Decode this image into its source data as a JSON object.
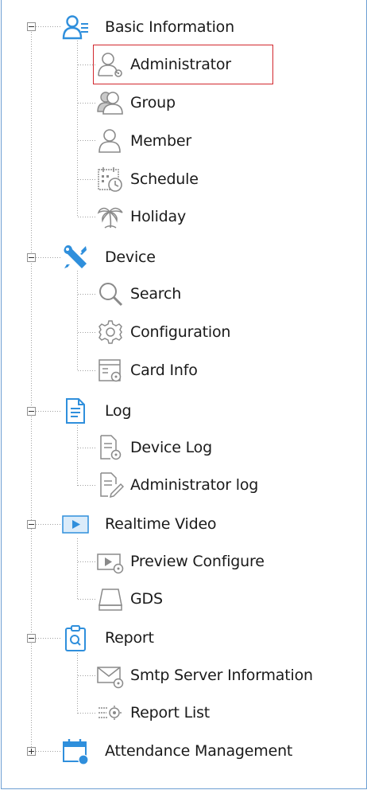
{
  "tree": {
    "groups": [
      {
        "label": "Basic Information",
        "icon": "user-list-icon",
        "expanded": true,
        "children": [
          {
            "label": "Administrator",
            "icon": "admin-user-gear-icon",
            "selected": true
          },
          {
            "label": "Group",
            "icon": "user-group-icon"
          },
          {
            "label": "Member",
            "icon": "user-icon"
          },
          {
            "label": "Schedule",
            "icon": "calendar-clock-icon"
          },
          {
            "label": "Holiday",
            "icon": "palm-tree-icon"
          }
        ]
      },
      {
        "label": "Device",
        "icon": "tools-icon",
        "expanded": true,
        "children": [
          {
            "label": "Search",
            "icon": "magnifier-icon"
          },
          {
            "label": "Configuration",
            "icon": "gear-icon"
          },
          {
            "label": "Card Info",
            "icon": "card-gear-icon"
          }
        ]
      },
      {
        "label": "Log",
        "icon": "document-icon",
        "expanded": true,
        "children": [
          {
            "label": "Device Log",
            "icon": "document-gear-icon"
          },
          {
            "label": "Administrator log",
            "icon": "document-pen-icon"
          }
        ]
      },
      {
        "label": "Realtime Video",
        "icon": "play-icon",
        "expanded": true,
        "children": [
          {
            "label": "Preview Configure",
            "icon": "play-gear-icon"
          },
          {
            "label": "GDS",
            "icon": "device-box-icon"
          }
        ]
      },
      {
        "label": "Report",
        "icon": "clipboard-search-icon",
        "expanded": true,
        "children": [
          {
            "label": "Smtp Server Information",
            "icon": "mail-gear-icon"
          },
          {
            "label": "Report List",
            "icon": "list-gear-icon"
          }
        ]
      },
      {
        "label": "Attendance Management",
        "icon": "calendar-user-icon",
        "expanded": false,
        "children": []
      }
    ]
  },
  "colors": {
    "accent": "#2f8fdc",
    "border": "#6d9fd3",
    "selection": "#d2282e",
    "icon_gray": "#8a8a8a",
    "tree_line": "#a0a0a0"
  }
}
